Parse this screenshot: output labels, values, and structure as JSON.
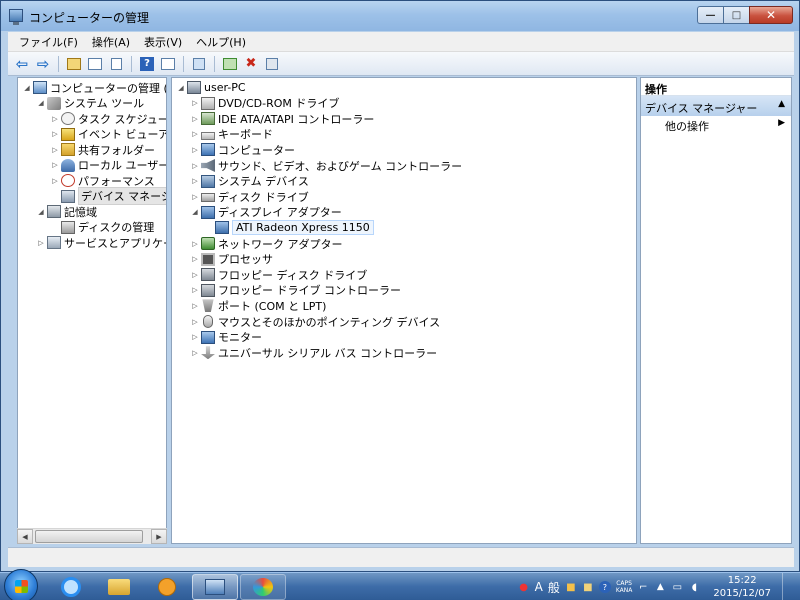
{
  "window": {
    "title": "コンピューターの管理",
    "minimize": "—",
    "maximize": "□",
    "close": "✕"
  },
  "menu": [
    "ファイル(F)",
    "操作(A)",
    "表示(V)",
    "ヘルプ(H)"
  ],
  "left_tree": [
    {
      "label": "コンピューターの管理 (ローカ",
      "indent": 0,
      "expander": "◢",
      "icon": "computer-management-icon"
    },
    {
      "label": "システム ツール",
      "indent": 1,
      "expander": "◢",
      "icon": "system-tools-icon"
    },
    {
      "label": "タスク スケジューラ",
      "indent": 2,
      "expander": "▷",
      "icon": "task-scheduler-icon"
    },
    {
      "label": "イベント ビューアー",
      "indent": 2,
      "expander": "▷",
      "icon": "event-viewer-icon"
    },
    {
      "label": "共有フォルダー",
      "indent": 2,
      "expander": "▷",
      "icon": "shared-folders-icon"
    },
    {
      "label": "ローカル ユーザーとグ",
      "indent": 2,
      "expander": "▷",
      "icon": "local-users-icon"
    },
    {
      "label": "パフォーマンス",
      "indent": 2,
      "expander": "▷",
      "icon": "performance-icon"
    },
    {
      "label": "デバイス マネージャー",
      "indent": 2,
      "expander": "",
      "icon": "device-manager-icon",
      "selected": true
    },
    {
      "label": "記憶域",
      "indent": 1,
      "expander": "◢",
      "icon": "storage-icon"
    },
    {
      "label": "ディスクの管理",
      "indent": 2,
      "expander": "",
      "icon": "disk-management-icon"
    },
    {
      "label": "サービスとアプリケーショ",
      "indent": 1,
      "expander": "▷",
      "icon": "services-applications-icon"
    }
  ],
  "device_tree": [
    {
      "label": "user-PC",
      "indent": 0,
      "expander": "◢",
      "icon": "pc-icon"
    },
    {
      "label": "DVD/CD-ROM ドライブ",
      "indent": 1,
      "expander": "▷",
      "icon": "dvd-drive-icon"
    },
    {
      "label": "IDE ATA/ATAPI コントローラー",
      "indent": 1,
      "expander": "▷",
      "icon": "ide-controller-icon"
    },
    {
      "label": "キーボード",
      "indent": 1,
      "expander": "▷",
      "icon": "keyboard-icon"
    },
    {
      "label": "コンピューター",
      "indent": 1,
      "expander": "▷",
      "icon": "computer-icon"
    },
    {
      "label": "サウンド、ビデオ、およびゲーム コントローラー",
      "indent": 1,
      "expander": "▷",
      "icon": "sound-icon"
    },
    {
      "label": "システム デバイス",
      "indent": 1,
      "expander": "▷",
      "icon": "system-devices-icon"
    },
    {
      "label": "ディスク ドライブ",
      "indent": 1,
      "expander": "▷",
      "icon": "disk-drive-icon"
    },
    {
      "label": "ディスプレイ アダプター",
      "indent": 1,
      "expander": "◢",
      "icon": "display-adapter-icon"
    },
    {
      "label": "ATI Radeon Xpress 1150",
      "indent": 2,
      "expander": "",
      "icon": "display-adapter-icon",
      "selected": true
    },
    {
      "label": "ネットワーク アダプター",
      "indent": 1,
      "expander": "▷",
      "icon": "network-adapter-icon"
    },
    {
      "label": "プロセッサ",
      "indent": 1,
      "expander": "▷",
      "icon": "processor-icon"
    },
    {
      "label": "フロッピー ディスク ドライブ",
      "indent": 1,
      "expander": "▷",
      "icon": "floppy-drive-icon"
    },
    {
      "label": "フロッピー ドライブ コントローラー",
      "indent": 1,
      "expander": "▷",
      "icon": "floppy-controller-icon"
    },
    {
      "label": "ポート (COM と LPT)",
      "indent": 1,
      "expander": "▷",
      "icon": "port-icon"
    },
    {
      "label": "マウスとそのほかのポインティング デバイス",
      "indent": 1,
      "expander": "▷",
      "icon": "mouse-icon"
    },
    {
      "label": "モニター",
      "indent": 1,
      "expander": "▷",
      "icon": "monitor-icon"
    },
    {
      "label": "ユニバーサル シリアル バス コントローラー",
      "indent": 1,
      "expander": "▷",
      "icon": "usb-controller-icon"
    }
  ],
  "actions": {
    "header": "操作",
    "section": "デバイス マネージャー",
    "section_arrow": "▲",
    "item": "他の操作",
    "item_arrow": "▶"
  },
  "tray": {
    "ime_mode": "A",
    "ime_label": "般",
    "caps": "CAPS",
    "kana": "KANA",
    "time": "15:22",
    "date": "2015/12/07"
  }
}
